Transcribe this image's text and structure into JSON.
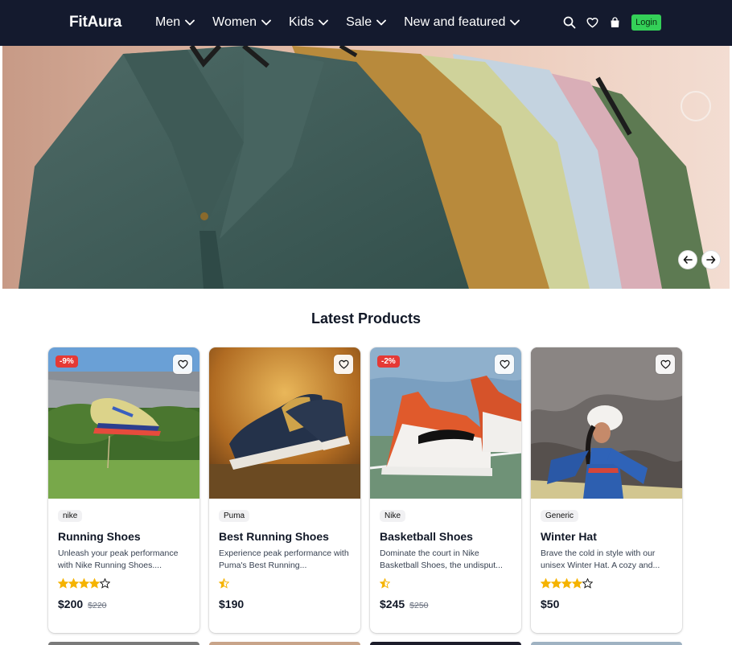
{
  "header": {
    "logo": "FitAura",
    "menu": [
      {
        "label": "Men"
      },
      {
        "label": "Women"
      },
      {
        "label": "Kids"
      },
      {
        "label": "Sale"
      },
      {
        "label": "New and featured"
      }
    ],
    "login_label": "Login",
    "icons": [
      "search-icon",
      "heart-icon",
      "bag-icon"
    ],
    "bg_color": "#141a2e",
    "login_color": "#34d058"
  },
  "hero": {
    "prev_icon": "arrow-left-icon",
    "next_icon": "arrow-right-icon"
  },
  "section": {
    "title": "Latest Products"
  },
  "products": [
    {
      "discount": "-9%",
      "brand": "nike",
      "name": "Running Shoes",
      "description": "Unleash your peak performance with Nike Running Shoes....",
      "rating": 4,
      "price": "$200",
      "old_price": "$220"
    },
    {
      "discount": "",
      "brand": "Puma",
      "name": "Best Running Shoes",
      "description": "Experience peak performance with Puma's Best Running...",
      "rating": 0.5,
      "price": "$190",
      "old_price": ""
    },
    {
      "discount": "-2%",
      "brand": "Nike",
      "name": "Basketball Shoes",
      "description": "Dominate the court in Nike Basketball Shoes, the undisput...",
      "rating": 0.5,
      "price": "$245",
      "old_price": "$250"
    },
    {
      "discount": "",
      "brand": "Generic",
      "name": "Winter Hat",
      "description": "Brave the cold in style with our unisex Winter Hat. A cozy and...",
      "rating": 4,
      "price": "$50",
      "old_price": ""
    }
  ],
  "colors": {
    "star": "#f5b301",
    "discount_badge": "#e53935"
  }
}
